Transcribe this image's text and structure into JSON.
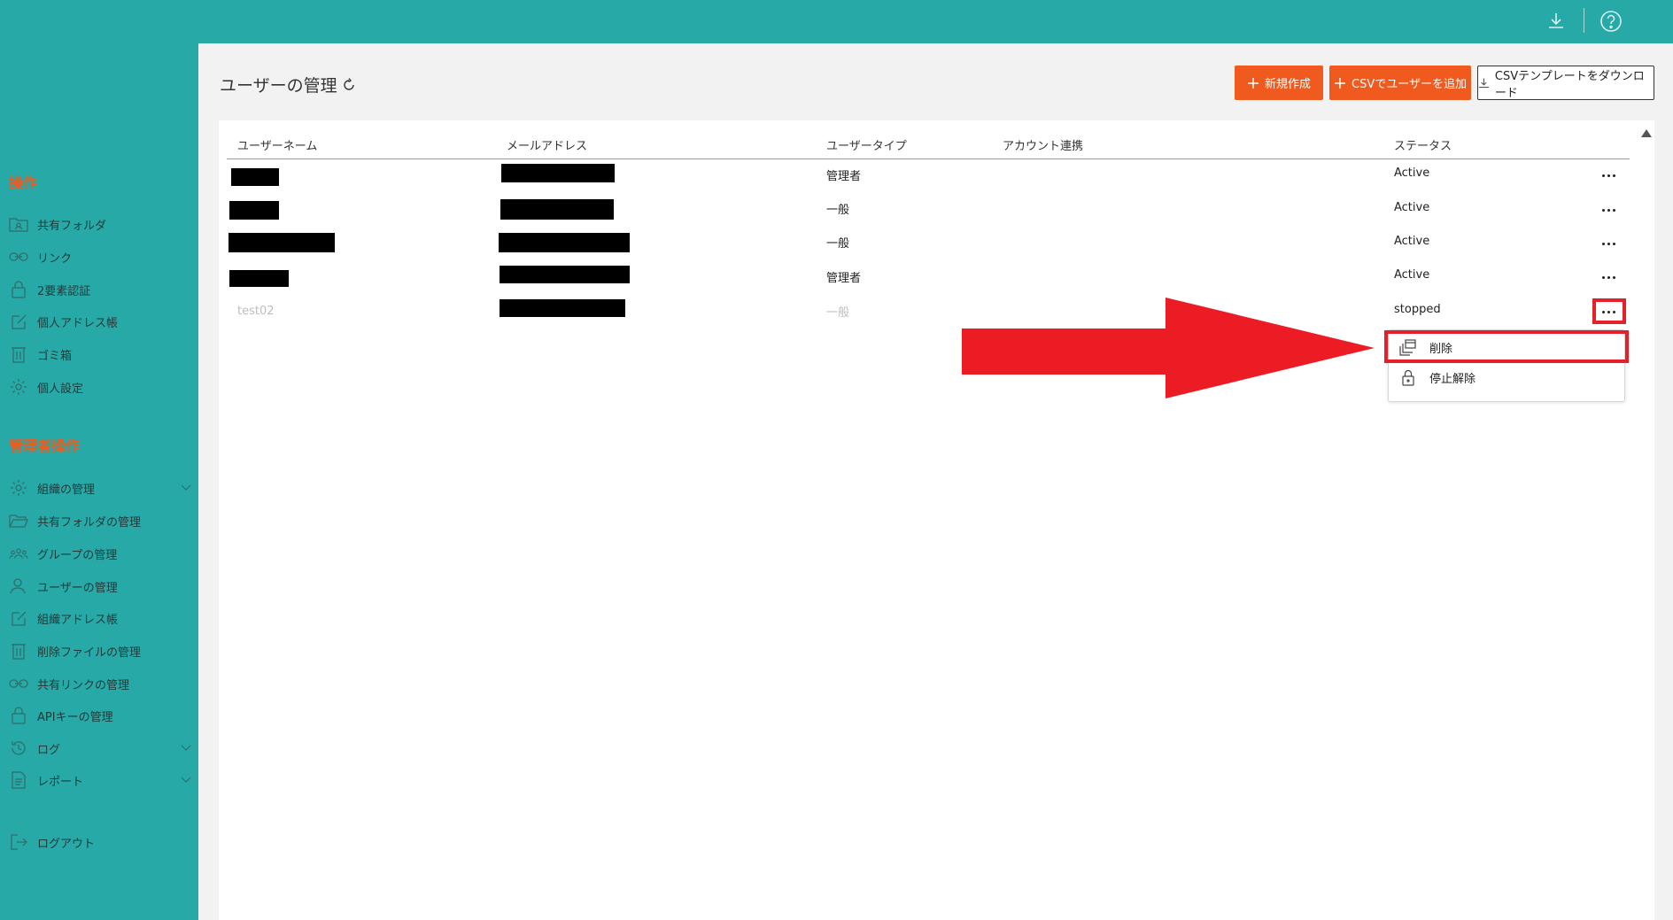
{
  "page": {
    "title": "ユーザーの管理"
  },
  "toolbar": {
    "new_label": "新規作成",
    "csv_add_label": "CSVでユーザーを追加",
    "csv_template_label": "CSVテンプレートをダウンロード"
  },
  "sidebar": {
    "section_ops": "操作",
    "ops_items": [
      "共有フォルダ",
      "リンク",
      "2要素認証",
      "個人アドレス帳",
      "ゴミ箱",
      "個人設定"
    ],
    "section_admin": "管理者操作",
    "admin_items": [
      "組織の管理",
      "共有フォルダの管理",
      "グループの管理",
      "ユーザーの管理",
      "組織アドレス帳",
      "削除ファイルの管理",
      "共有リンクの管理",
      "APIキーの管理",
      "ログ",
      "レポート"
    ],
    "logout": "ログアウト"
  },
  "table": {
    "headers": [
      "ユーザーネーム",
      "メールアドレス",
      "ユーザータイプ",
      "アカウント連携",
      "ステータス"
    ],
    "rows": [
      {
        "username": "",
        "email": "",
        "type": "管理者",
        "status": "Active"
      },
      {
        "username": "",
        "email": "",
        "type": "一般",
        "status": "Active"
      },
      {
        "username": "",
        "email": "",
        "type": "一般",
        "status": "Active"
      },
      {
        "username": "",
        "email": "",
        "type": "管理者",
        "status": "Active"
      },
      {
        "username": "test02",
        "email": "",
        "type": "一般",
        "status": "stopped"
      }
    ]
  },
  "menu": {
    "delete": "削除",
    "unsuspend": "停止解除"
  },
  "colors": {
    "teal": "#26a9a7",
    "orange": "#f15a1e",
    "highlight_red": "#e5202a"
  }
}
